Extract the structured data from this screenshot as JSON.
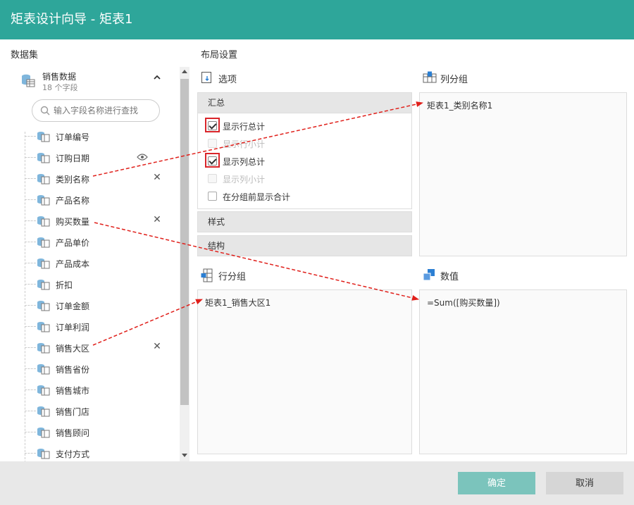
{
  "window": {
    "title": "矩表设计向导 - 矩表1"
  },
  "dataset_label": "数据集",
  "layout_label": "布局设置",
  "dataset": {
    "name": "销售数据",
    "field_count": "18 个字段"
  },
  "search": {
    "placeholder": "输入字段名称进行查找"
  },
  "fields": [
    {
      "name": "订单编号"
    },
    {
      "name": "订购日期"
    },
    {
      "name": "类别名称"
    },
    {
      "name": "产品名称"
    },
    {
      "name": "购买数量"
    },
    {
      "name": "产品单价"
    },
    {
      "name": "产品成本"
    },
    {
      "name": "折扣"
    },
    {
      "name": "订单金额"
    },
    {
      "name": "订单利润"
    },
    {
      "name": "销售大区"
    },
    {
      "name": "销售省份"
    },
    {
      "name": "销售城市"
    },
    {
      "name": "销售门店"
    },
    {
      "name": "销售顾问"
    },
    {
      "name": "支付方式"
    }
  ],
  "options": {
    "title": "选项",
    "summary_header": "汇总",
    "items": [
      {
        "label": "显示行总计",
        "checked": true,
        "disabled": false,
        "highlighted": true
      },
      {
        "label": "显示行小计",
        "checked": false,
        "disabled": true,
        "highlighted": false
      },
      {
        "label": "显示列总计",
        "checked": true,
        "disabled": false,
        "highlighted": true
      },
      {
        "label": "显示列小计",
        "checked": false,
        "disabled": true,
        "highlighted": false
      },
      {
        "label": "在分组前显示合计",
        "checked": false,
        "disabled": false,
        "highlighted": false
      }
    ],
    "style_header": "样式",
    "structure_header": "结构"
  },
  "column_group": {
    "title": "列分组",
    "items": [
      "矩表1_类别名称1"
    ]
  },
  "row_group": {
    "title": "行分组",
    "items": [
      "矩表1_销售大区1"
    ]
  },
  "values": {
    "title": "数值",
    "items": [
      "=Sum([购买数量])"
    ]
  },
  "buttons": {
    "ok": "确定",
    "cancel": "取消"
  },
  "colors": {
    "header": "#2ea69a",
    "ok_button": "#7bc4bc",
    "highlight": "#d9252a",
    "arrow": "#e0201b"
  }
}
